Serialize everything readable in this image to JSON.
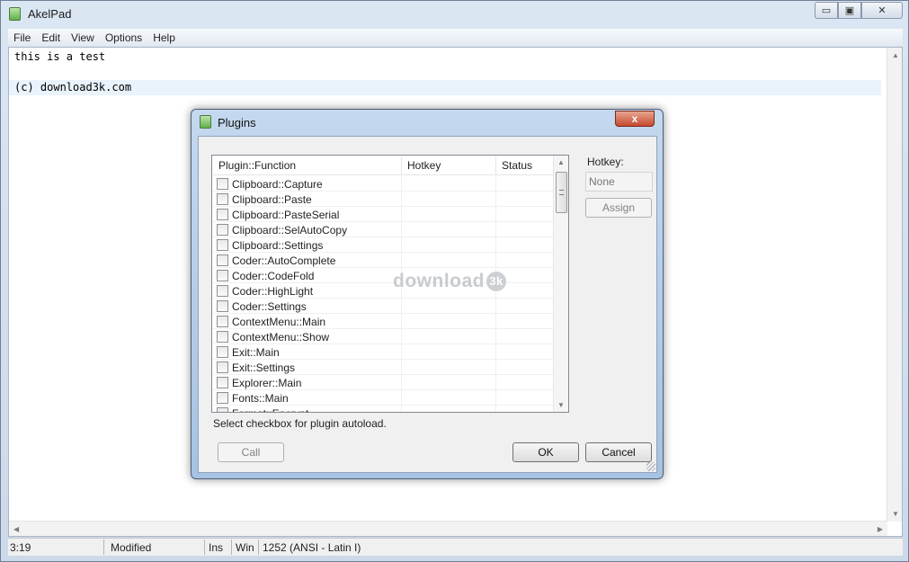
{
  "window": {
    "title": "AkelPad",
    "icon": "notepad-icon"
  },
  "caption_buttons": {
    "minimize": "▭",
    "maximize": "▣",
    "close": "✕"
  },
  "menu": [
    "File",
    "Edit",
    "View",
    "Options",
    "Help"
  ],
  "editor": {
    "lines": [
      "this is a test",
      "",
      "(c) download3k.com"
    ],
    "current_line_color": "#e9f3fb"
  },
  "statusbar": {
    "position": "3:19",
    "modified": "Modified",
    "insert_mode": "Ins",
    "newline": "Win",
    "codepage": "1252  (ANSI - Latin I)"
  },
  "watermark": {
    "text": "download",
    "badge": "3k"
  },
  "dialog": {
    "title": "Plugins",
    "close_label": "x",
    "columns": [
      "Plugin::Function",
      "Hotkey",
      "Status"
    ],
    "rows": [
      "Clipboard::Capture",
      "Clipboard::Paste",
      "Clipboard::PasteSerial",
      "Clipboard::SelAutoCopy",
      "Clipboard::Settings",
      "Coder::AutoComplete",
      "Coder::CodeFold",
      "Coder::HighLight",
      "Coder::Settings",
      "ContextMenu::Main",
      "ContextMenu::Show",
      "Exit::Main",
      "Exit::Settings",
      "Explorer::Main",
      "Fonts::Main",
      "Format::Encrypt"
    ],
    "hotkey_label": "Hotkey:",
    "hotkey_value": "None",
    "assign_label": "Assign",
    "hint": "Select checkbox for plugin autoload.",
    "call_label": "Call",
    "ok_label": "OK",
    "cancel_label": "Cancel"
  }
}
